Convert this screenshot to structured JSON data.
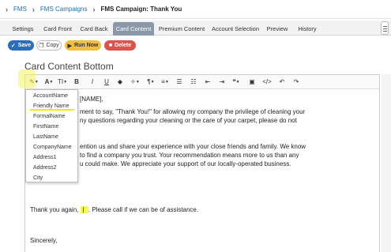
{
  "breadcrumb": {
    "items": [
      "FMS",
      "FMS Campaigns"
    ],
    "current": "FMS Campaign: Thank You"
  },
  "tabs": [
    {
      "label": "Settings",
      "active": false
    },
    {
      "label": "Card Front",
      "active": false
    },
    {
      "label": "Card Back",
      "active": false
    },
    {
      "label": "Card Content",
      "active": true
    },
    {
      "label": "Premium Content",
      "active": false
    },
    {
      "label": "Account Selection",
      "active": false
    },
    {
      "label": "Preview",
      "active": false
    },
    {
      "label": "History",
      "active": false
    }
  ],
  "actions": {
    "save": "Save",
    "copy": "Copy",
    "run_now": "Run Now",
    "delete": "Delete"
  },
  "section_title": "Card Content Bottom",
  "toolbar": {
    "buttons": [
      "merge-field",
      "font-color",
      "font-size",
      "bold",
      "italic",
      "underline",
      "highlight",
      "style",
      "paragraph",
      "align",
      "ordered-list",
      "unordered-list",
      "outdent",
      "indent",
      "quote",
      "image",
      "code",
      "undo",
      "redo"
    ]
  },
  "merge_fields": {
    "items": [
      "AccountName",
      "Friendly Name",
      "FormalName",
      "FirstName",
      "LastName",
      "CompanyName",
      "Address1",
      "Address2",
      "City"
    ],
    "highlighted": "Friendly Name"
  },
  "editor": {
    "line1": "[NAME],",
    "line2": "ment to say, \"Thank You!\" for allowing my company the privilege of cleaning your",
    "line3": "ny questions regarding your cleaning or the care of your carpet, please do not",
    "line4": "ention us and share your experience with your close friends and family. We know",
    "line5": "to find a company you trust. Your recommendation means more to us than any",
    "line6": "u could make. We appreciate your support of our locally-operated business.",
    "thanks_before": "Thank you again,",
    "thanks_token": " | ",
    "thanks_after": ". Please call if we can be of assistance.",
    "closing": "Sincerely,"
  },
  "colors": {
    "save": "#2d6eb8",
    "run_now": "#f0c040",
    "delete": "#d9534f",
    "active_tab": "#8a98a8",
    "highlight": "#f7f55c",
    "link": "#1b6fb5"
  }
}
